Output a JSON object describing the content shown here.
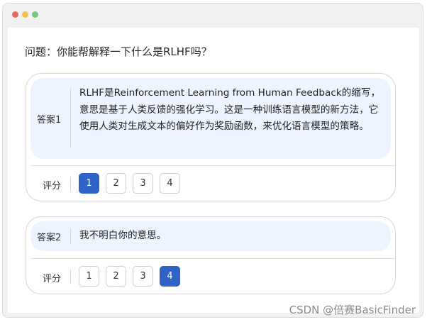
{
  "window": {
    "traffic_lights": [
      {
        "name": "close",
        "color": "#e26a5f"
      },
      {
        "name": "minimize",
        "color": "#f3c14c"
      },
      {
        "name": "maximize",
        "color": "#7fc37a"
      }
    ]
  },
  "question": "问题：你能帮解释一下什么是RLHF吗？",
  "answers": [
    {
      "label": "答案1",
      "text": "RLHF是Reinforcement Learning from Human Feedback的缩写，意思是基于人类反馈的强化学习。这是一种训练语言模型的新方法，它使用人类对生成文本的偏好作为奖励函数，来优化语言模型的策略。",
      "rating_label": "评分",
      "scores": [
        "1",
        "2",
        "3",
        "4"
      ],
      "selected_score": "1"
    },
    {
      "label": "答案2",
      "text": "我不明白你的意思。",
      "rating_label": "评分",
      "scores": [
        "1",
        "2",
        "3",
        "4"
      ],
      "selected_score": "4"
    }
  ],
  "colors": {
    "accent": "#2f63c8",
    "answer_bg": "#eef4ff"
  },
  "watermark": "CSDN @倍赛BasicFinder"
}
